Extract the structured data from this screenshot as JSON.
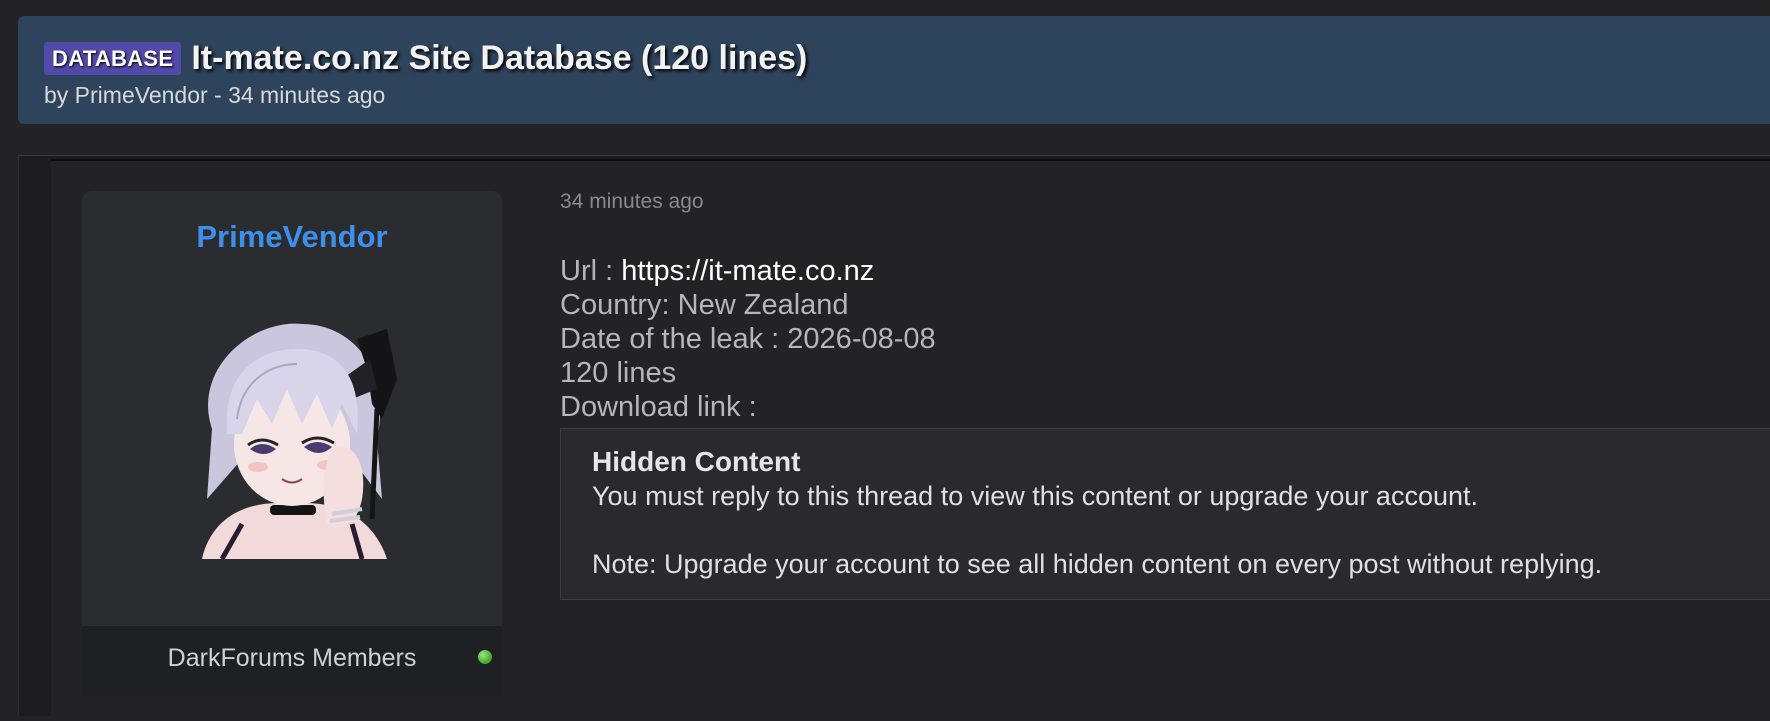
{
  "thread": {
    "prefix": "DATABASE",
    "title": "It-mate.co.nz Site Database (120 lines)",
    "byline": "by PrimeVendor - 34 minutes ago"
  },
  "author": {
    "name": "PrimeVendor",
    "group": "DarkForums Members",
    "status": "online"
  },
  "post": {
    "date": "34 minutes ago",
    "url_label": "Url : ",
    "url_value": "https://it-mate.co.nz",
    "country": "Country: New Zealand",
    "leak_date": "Date of the leak : 2026-08-08",
    "lines": "120 lines",
    "download": "Download link :",
    "hidden": {
      "title": "Hidden Content",
      "text": "You must reply to this thread to view this content or upgrade your account.",
      "note": "Note: Upgrade your account to see all hidden content on every post without replying."
    }
  },
  "colors": {
    "header_bg": "#2e445c",
    "prefix_bg": "#5349a8",
    "username": "#3f8eea",
    "online": "#3fa524"
  }
}
